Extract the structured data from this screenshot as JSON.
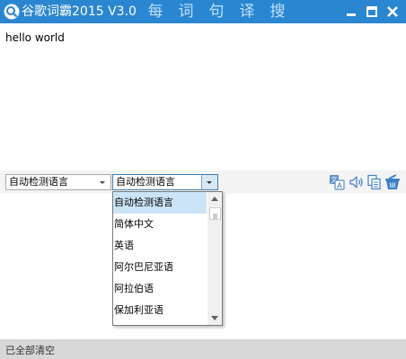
{
  "window": {
    "title": "谷歌词霸2015 V3.0",
    "colors": {
      "titlebar": "#2a86d0",
      "nav_text": "#bfe0ff",
      "selection": "#cce4f7",
      "status_bar": "#d7d7d7"
    }
  },
  "nav": {
    "tabs": [
      "每",
      "词",
      "句",
      "译",
      "搜"
    ]
  },
  "input": {
    "text": "hello world"
  },
  "language": {
    "source_value": "自动检测语言",
    "target_value": "自动检测语言",
    "dropdown_items": [
      "自动检测语言",
      "简体中文",
      "英语",
      "阿尔巴尼亚语",
      "阿拉伯语",
      "保加利亚语"
    ],
    "dropdown_selected_index": 0,
    "scroll_position": 0
  },
  "toolbar": {
    "icons": [
      "translate-icon",
      "speaker-icon",
      "copy-icon",
      "clear-icon"
    ]
  },
  "status": {
    "text": "已全部清空"
  }
}
